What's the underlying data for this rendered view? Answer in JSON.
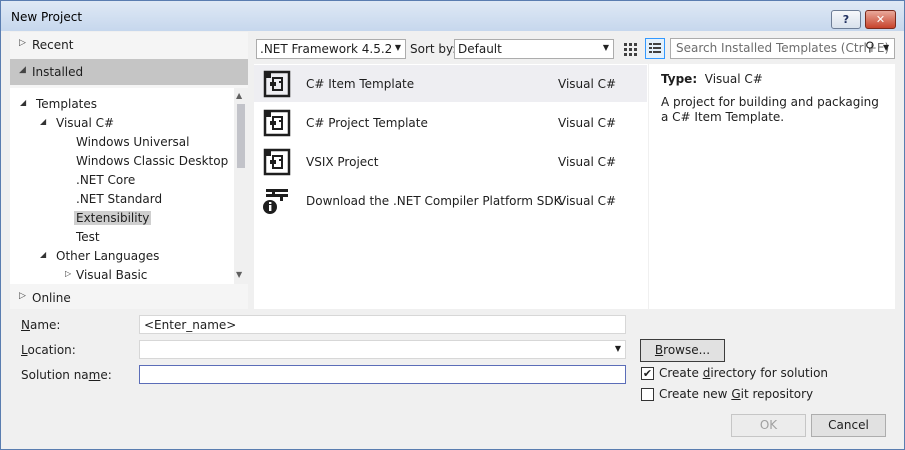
{
  "window": {
    "title": "New Project",
    "help_label": "?",
    "close_label": "✕"
  },
  "nav": {
    "recent": "Recent",
    "installed": "Installed",
    "online": "Online",
    "tree": [
      {
        "label": "Templates",
        "level": 0,
        "expanded": true
      },
      {
        "label": "Visual C#",
        "level": 1,
        "expanded": true
      },
      {
        "label": "Windows Universal",
        "level": 2
      },
      {
        "label": "Windows Classic Desktop",
        "level": 2
      },
      {
        "label": ".NET Core",
        "level": 2
      },
      {
        "label": ".NET Standard",
        "level": 2
      },
      {
        "label": "Extensibility",
        "level": 2,
        "selected": true
      },
      {
        "label": "Test",
        "level": 2
      },
      {
        "label": "Other Languages",
        "level": 1,
        "expanded": true
      },
      {
        "label": "Visual Basic",
        "level": 2,
        "expanded": false
      }
    ]
  },
  "toolbar": {
    "framework": ".NET Framework 4.5.2",
    "sort_label": "Sort by:",
    "sort_value": "Default",
    "search_placeholder": "Search Installed Templates (Ctrl+E)"
  },
  "templates": [
    {
      "name": "C# Item Template",
      "lang": "Visual C#",
      "icon": "item-template-icon",
      "selected": true
    },
    {
      "name": "C# Project Template",
      "lang": "Visual C#",
      "icon": "project-template-icon"
    },
    {
      "name": "VSIX Project",
      "lang": "Visual C#",
      "icon": "vsix-project-icon"
    },
    {
      "name": "Download the .NET Compiler Platform SDK",
      "lang": "Visual C#",
      "icon": "download-sdk-icon"
    }
  ],
  "details": {
    "type_label": "Type:",
    "type_value": "Visual C#",
    "description": "A project for building and packaging a C# Item Template."
  },
  "form": {
    "name_label_u": "N",
    "name_label_rest": "ame:",
    "name_value": "<Enter_name>",
    "location_label_u": "L",
    "location_label_rest": "ocation:",
    "location_value": "",
    "solution_label_pre": "Solution na",
    "solution_label_u": "m",
    "solution_label_post": "e:",
    "solution_value": "",
    "browse_label_u": "B",
    "browse_label_rest": "rowse...",
    "create_dir_pre": "Create ",
    "create_dir_u": "d",
    "create_dir_post": "irectory for solution",
    "create_dir_checked": true,
    "create_git_pre": "Create new ",
    "create_git_u": "G",
    "create_git_post": "it repository",
    "create_git_checked": false,
    "ok_label": "OK",
    "cancel_label": "Cancel"
  }
}
